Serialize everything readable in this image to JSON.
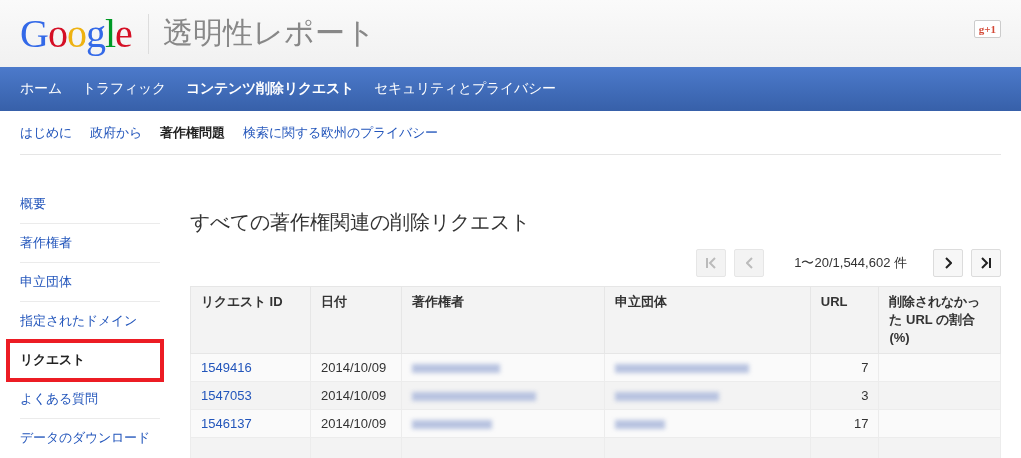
{
  "header": {
    "logo": "Google",
    "title": "透明性レポート",
    "plus_button": "g+1"
  },
  "main_nav": [
    {
      "label": "ホーム",
      "selected": false
    },
    {
      "label": "トラフィック",
      "selected": false
    },
    {
      "label": "コンテンツ削除リクエスト",
      "selected": true
    },
    {
      "label": "セキュリティとプライバシー",
      "selected": false
    }
  ],
  "sub_nav": [
    {
      "label": "はじめに",
      "selected": false
    },
    {
      "label": "政府から",
      "selected": false
    },
    {
      "label": "著作権問題",
      "selected": true
    },
    {
      "label": "検索に関する欧州のプライバシー",
      "selected": false
    }
  ],
  "sidebar": {
    "items": [
      {
        "label": "概要",
        "selected": false
      },
      {
        "label": "著作権者",
        "selected": false
      },
      {
        "label": "申立団体",
        "selected": false
      },
      {
        "label": "指定されたドメイン",
        "selected": false
      },
      {
        "label": "リクエスト",
        "selected": true
      },
      {
        "label": "よくある質問",
        "selected": false
      },
      {
        "label": "データのダウンロード",
        "selected": false
      }
    ]
  },
  "content": {
    "title": "すべての著作権関連の削除リクエスト",
    "pagination": {
      "buttons": [
        {
          "kind": "first",
          "disabled": true
        },
        {
          "kind": "prev",
          "disabled": true
        },
        {
          "kind": "next",
          "disabled": false
        },
        {
          "kind": "last",
          "disabled": false
        }
      ],
      "range": "1〜20/1,544,602 件"
    },
    "table": {
      "columns": [
        "リクエスト ID",
        "日付",
        "著作権者",
        "申立団体",
        "URL",
        "削除されなかった URL の割合 (%)"
      ],
      "rows": [
        {
          "id": "1549416",
          "date": "2014/10/09",
          "urls": "7"
        },
        {
          "id": "1547053",
          "date": "2014/10/09",
          "urls": "3"
        },
        {
          "id": "1546137",
          "date": "2014/10/09",
          "urls": "17"
        }
      ]
    }
  }
}
